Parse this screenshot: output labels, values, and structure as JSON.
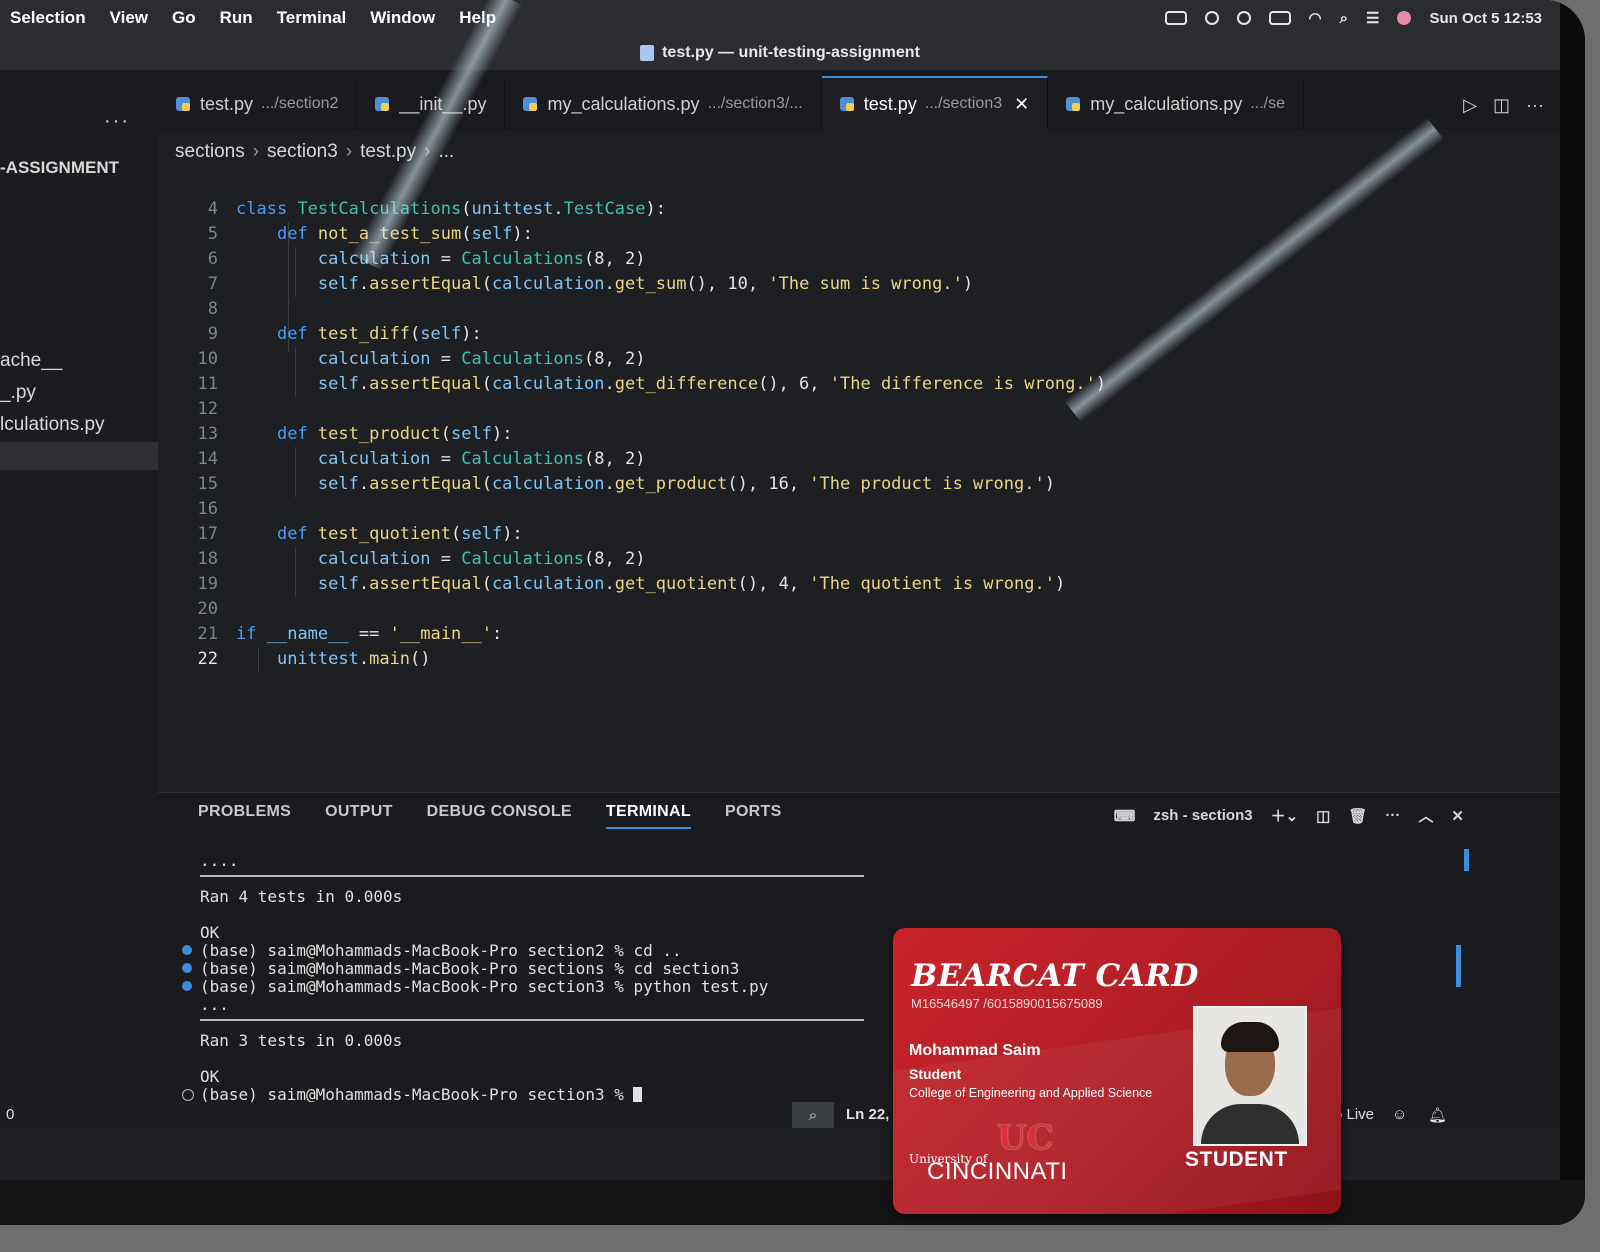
{
  "menubar": {
    "items": [
      "Selection",
      "View",
      "Go",
      "Run",
      "Terminal",
      "Window",
      "Help"
    ],
    "clock": "Sun Oct 5  12:53"
  },
  "window": {
    "title": "test.py — unit-testing-assignment"
  },
  "sidebar": {
    "more": "···",
    "heading": "-ASSIGNMENT",
    "files": [
      "ache__",
      "_.py",
      "lculations.py"
    ]
  },
  "tabs": [
    {
      "label": "test.py",
      "path": ".../section2",
      "active": false
    },
    {
      "label": "__init__.py",
      "path": "",
      "active": false
    },
    {
      "label": "my_calculations.py",
      "path": ".../section3/...",
      "active": false
    },
    {
      "label": "test.py",
      "path": ".../section3",
      "active": true
    },
    {
      "label": "my_calculations.py",
      "path": ".../se",
      "active": false
    }
  ],
  "tab_close": "✕",
  "breadcrumb": [
    "sections",
    "section3",
    "test.py",
    "..."
  ],
  "code_lines": [
    {
      "n": "4",
      "code": "class TestCalculations(unittest.TestCase):"
    },
    {
      "n": "5",
      "code": "    def not_a_test_sum(self):"
    },
    {
      "n": "6",
      "code": "        calculation = Calculations(8, 2)"
    },
    {
      "n": "7",
      "code": "        self.assertEqual(calculation.get_sum(), 10, 'The sum is wrong.')"
    },
    {
      "n": "8",
      "code": ""
    },
    {
      "n": "9",
      "code": "    def test_diff(self):"
    },
    {
      "n": "10",
      "code": "        calculation = Calculations(8, 2)"
    },
    {
      "n": "11",
      "code": "        self.assertEqual(calculation.get_difference(), 6, 'The difference is wrong.')"
    },
    {
      "n": "12",
      "code": ""
    },
    {
      "n": "13",
      "code": "    def test_product(self):"
    },
    {
      "n": "14",
      "code": "        calculation = Calculations(8, 2)"
    },
    {
      "n": "15",
      "code": "        self.assertEqual(calculation.get_product(), 16, 'The product is wrong.')"
    },
    {
      "n": "16",
      "code": ""
    },
    {
      "n": "17",
      "code": "    def test_quotient(self):"
    },
    {
      "n": "18",
      "code": "        calculation = Calculations(8, 2)"
    },
    {
      "n": "19",
      "code": "        self.assertEqual(calculation.get_quotient(), 4, 'The quotient is wrong.')"
    },
    {
      "n": "20",
      "code": ""
    },
    {
      "n": "21",
      "code": "if __name__ == '__main__':"
    },
    {
      "n": "22",
      "code": "    unittest.main()"
    }
  ],
  "panel": {
    "tabs": [
      "PROBLEMS",
      "OUTPUT",
      "DEBUG CONSOLE",
      "TERMINAL",
      "PORTS"
    ],
    "active_tab": "TERMINAL",
    "terminal_name": "zsh - section3"
  },
  "terminal": {
    "dots1": "....",
    "ran1": "Ran 4 tests in 0.000s",
    "ok1": "OK",
    "cmd1": "(base) saim@Mohammads-MacBook-Pro section2 % cd ..",
    "cmd2": "(base) saim@Mohammads-MacBook-Pro sections % cd section3",
    "cmd3": "(base) saim@Mohammads-MacBook-Pro section3 % python test.py",
    "dots2": "...",
    "ran2": "Ran 3 tests in 0.000s",
    "ok2": "OK",
    "prompt": "(base) saim@Mohammads-MacBook-Pro section3 % "
  },
  "statusbar": {
    "left": "0",
    "position": "Ln 22,",
    "live": "o Live"
  },
  "id_card": {
    "title": "BEARCAT CARD",
    "number": "M16546497 /6015890015675089",
    "name": "Mohammad Saim",
    "role": "Student",
    "college": "College of Engineering and Applied Science",
    "uni_small": "University of",
    "uni_big": "CINCINNATI",
    "logo": "UC",
    "badge": "STUDENT"
  },
  "colors": {
    "accent": "#3c8de0",
    "editor_bg": "#1e1f22",
    "card_red": "#c8232c"
  }
}
